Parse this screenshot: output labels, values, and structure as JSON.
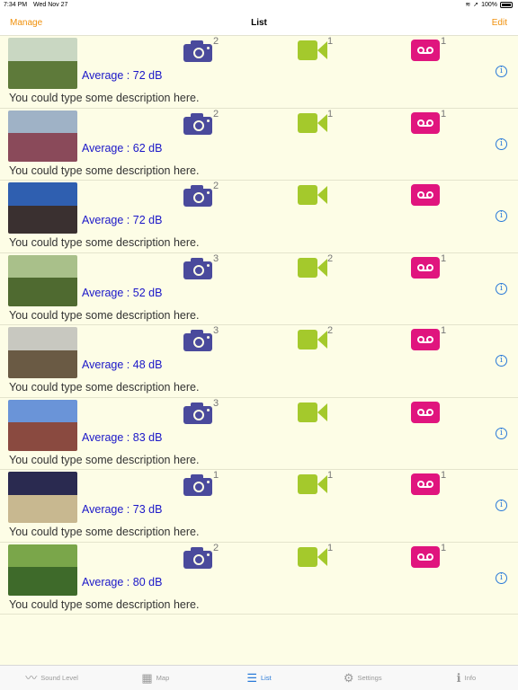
{
  "status": {
    "time": "7:34 PM",
    "date": "Wed Nov 27",
    "battery": "100%"
  },
  "nav": {
    "left": "Manage",
    "title": "List",
    "right": "Edit"
  },
  "rows": [
    {
      "average": "Average : 72 dB",
      "description": "You could type some description here.",
      "photos": "2",
      "videos": "1",
      "recordings": "1",
      "thumb": {
        "sky": "#c9d7c2",
        "ground": "#5e7a3a"
      }
    },
    {
      "average": "Average : 62 dB",
      "description": "You could type some description here.",
      "photos": "2",
      "videos": "1",
      "recordings": "1",
      "thumb": {
        "sky": "#9fb2c6",
        "ground": "#8a4a5a"
      }
    },
    {
      "average": "Average : 72 dB",
      "description": "You could type some description here.",
      "photos": "2",
      "videos": "",
      "recordings": "",
      "thumb": {
        "sky": "#2f5fb0",
        "ground": "#3a3030"
      }
    },
    {
      "average": "Average : 52 dB",
      "description": "You could type some description here.",
      "photos": "3",
      "videos": "2",
      "recordings": "1",
      "thumb": {
        "sky": "#a9c08a",
        "ground": "#4f6a30"
      }
    },
    {
      "average": "Average : 48 dB",
      "description": "You could type some description here.",
      "photos": "3",
      "videos": "2",
      "recordings": "1",
      "thumb": {
        "sky": "#c8c8c0",
        "ground": "#6a5a44"
      }
    },
    {
      "average": "Average : 83 dB",
      "description": "You could type some description here.",
      "photos": "3",
      "videos": "",
      "recordings": "",
      "thumb": {
        "sky": "#6a94d8",
        "ground": "#8a4a40"
      }
    },
    {
      "average": "Average : 73 dB",
      "description": "You could type some description here.",
      "photos": "1",
      "videos": "1",
      "recordings": "1",
      "thumb": {
        "sky": "#2a2a50",
        "ground": "#c8b890"
      }
    },
    {
      "average": "Average : 80 dB",
      "description": "You could type some description here.",
      "photos": "2",
      "videos": "1",
      "recordings": "1",
      "thumb": {
        "sky": "#7aa64a",
        "ground": "#3e6a2a"
      }
    }
  ],
  "tabs": [
    {
      "label": "Sound Level",
      "icon": "waveform-icon",
      "glyph": "〰"
    },
    {
      "label": "Map",
      "icon": "map-icon",
      "glyph": "▦"
    },
    {
      "label": "List",
      "icon": "list-icon",
      "glyph": "☰"
    },
    {
      "label": "Settings",
      "icon": "gear-icon",
      "glyph": "⚙"
    },
    {
      "label": "Info",
      "icon": "info-icon",
      "glyph": "ℹ"
    }
  ],
  "colors": {
    "accent": "#f0900a",
    "avg_text": "#1b17c8",
    "camera": "#4a4a9c",
    "video": "#a4c92c",
    "recorder": "#e0157e",
    "active_tab": "#2a7ad8",
    "background": "#fdfde6"
  }
}
